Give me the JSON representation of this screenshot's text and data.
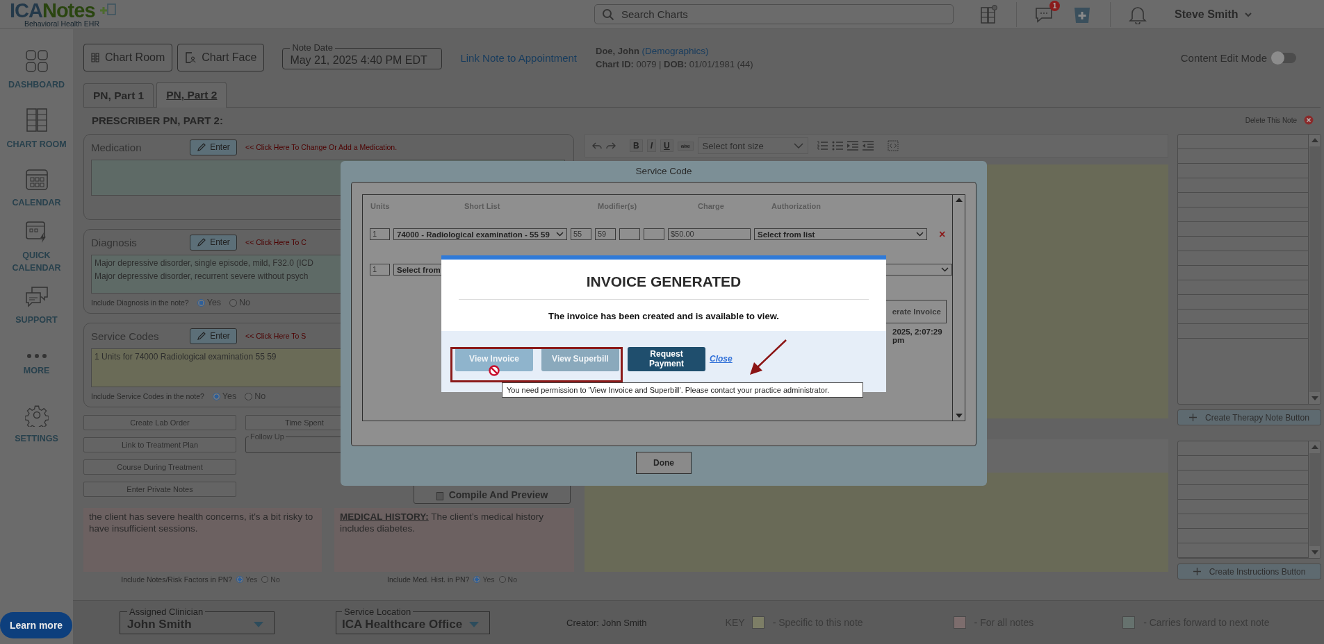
{
  "header": {
    "logo": {
      "brand_first": "ICA",
      "brand_second": "Notes",
      "tagline": "Behavioral Health EHR"
    },
    "search": {
      "placeholder": "Search Charts"
    },
    "message_badge": "1",
    "user": "Steve Smith"
  },
  "sidebar": {
    "items": [
      {
        "label": "DASHBOARD",
        "kind": "dashboard"
      },
      {
        "label": "CHART ROOM",
        "kind": "chart_room"
      },
      {
        "label": "CALENDAR",
        "kind": "calendar"
      },
      {
        "label": "QUICK CALENDAR",
        "kind": "quick_calendar"
      },
      {
        "label": "SUPPORT",
        "kind": "support"
      },
      {
        "label": "MORE",
        "kind": "more"
      },
      {
        "label": "SETTINGS",
        "kind": "settings"
      }
    ],
    "learn_more": "Learn more"
  },
  "toolbar": {
    "buttons": [
      {
        "label": "Chart Room",
        "kind": "chart_room"
      },
      {
        "label": "Chart Face",
        "kind": "chart_face"
      }
    ],
    "note_date": {
      "label": "Note Date",
      "value": "May 21, 2025 4:40 PM EDT"
    },
    "appointment_link": "Link Note to Appointment",
    "patient": {
      "name": "Doe, John",
      "demographics_link": "(Demographics)",
      "chart_id_label": "Chart ID:",
      "chart_id": "0079",
      "separator": "|",
      "dob_label": "DOB:",
      "dob": "01/01/1981 (44)"
    },
    "content_edit_mode": {
      "label": "Content Edit Mode",
      "on": false
    }
  },
  "tabs": [
    {
      "label": "PN, Part 1",
      "selected": false
    },
    {
      "label": "PN, Part 2",
      "selected": true
    }
  ],
  "note": {
    "heading": "PRESCRIBER PN, PART 2:",
    "delete_label": "Delete This Note"
  },
  "sections": [
    {
      "title": "Medication",
      "button": "Enter",
      "hint": "<< Click Here To Change Or Add a Medication.",
      "kind": "carries_forward"
    },
    {
      "title": "Diagnosis",
      "button": "Enter",
      "hint": "<< Click Here To C",
      "kind": "carries_forward",
      "lines": [
        "Major depressive disorder, single episode, mild, F32.0 (ICD",
        "Major depressive disorder, recurrent severe without psych"
      ],
      "include": {
        "label": "Include Diagnosis in the note?",
        "options": [
          {
            "label": "Yes",
            "selected": true
          },
          {
            "label": "No",
            "selected": false
          }
        ]
      }
    },
    {
      "title": "Service Codes",
      "button": "Enter",
      "hint": "<< Click Here To S",
      "kind": "specific",
      "lines": [
        "1 Units for 74000 Radiological examination 55 59"
      ],
      "include": {
        "label": "Include Service Codes in the note?",
        "options": [
          {
            "label": "Yes",
            "selected": true
          },
          {
            "label": "No",
            "selected": false
          }
        ]
      }
    }
  ],
  "actions": {
    "left_buttons": [
      "Create Lab Order",
      "Link to Treatment Plan",
      "Course During Treatment",
      "Enter Private Notes"
    ],
    "time_spent": "Time Spent",
    "follow_up": "Follow Up",
    "compile": "Compile And Preview"
  },
  "notes": [
    {
      "kind": "all_notes",
      "text": "the client has severe health concerns, it's a bit risky to have insufficient sessions.",
      "include": {
        "label": "Include Notes/Risk Factors in PN?",
        "options": [
          {
            "label": "Yes",
            "selected": true
          },
          {
            "label": "No",
            "selected": false
          }
        ]
      }
    },
    {
      "kind": "all_notes",
      "text": "**MEDICAL HISTORY:** The client’s medical history includes diabetes.",
      "include": {
        "label": "Include Med. Hist. in PN?",
        "options": [
          {
            "label": "Yes",
            "selected": true
          },
          {
            "label": "No",
            "selected": false
          }
        ]
      }
    }
  ],
  "editor": {
    "format_buttons": [
      "B",
      "I",
      "U",
      "abc"
    ],
    "font_size": {
      "placeholder": "Select font size"
    }
  },
  "side_lists": [
    {
      "button": "Create Therapy Note Button"
    },
    {
      "button": "Create Instructions Button"
    }
  ],
  "footer": {
    "assigned_clinician": {
      "label": "Assigned Clinician",
      "value": "John Smith"
    },
    "service_location": {
      "label": "Service Location",
      "value": "ICA Healthcare Office"
    },
    "creator": "Creator: John Smith",
    "key_label": "KEY",
    "key": [
      {
        "kind": "specific",
        "label": "- Specific to this note"
      },
      {
        "kind": "all_notes",
        "label": "- For all notes"
      },
      {
        "kind": "carries_forward",
        "label": "- Carries forward to next note"
      }
    ]
  },
  "service_code_dialog": {
    "title": "Service Code",
    "columns": [
      "Units",
      "Short List",
      "Modifier(s)",
      "Charge",
      "Authorization"
    ],
    "rows": [
      {
        "units": "1",
        "code": "74000 - Radiological examination - 55 59",
        "modifiers": [
          "55",
          "59"
        ],
        "charge": "$50.00",
        "authorization": "Select from list",
        "remove": "×"
      },
      {
        "units": "1",
        "code": "Select from"
      }
    ],
    "generate_button": "erate Invoice",
    "timestamp": "2025, 2:07:29 pm",
    "done": "Done"
  },
  "invoice_dialog": {
    "title": "INVOICE GENERATED",
    "message": "The invoice has been created and is available to view.",
    "buttons": [
      {
        "label": "View Invoice",
        "kind": "restricted",
        "disabled": true
      },
      {
        "label": "View Superbill",
        "kind": "restricted",
        "disabled": true
      },
      {
        "label": "Request Payment",
        "kind": "primary",
        "disabled": false
      }
    ],
    "close_link": "Close",
    "tooltip": "You need permission to 'View Invoice and Superbill'. Please contact your practice administrator."
  }
}
